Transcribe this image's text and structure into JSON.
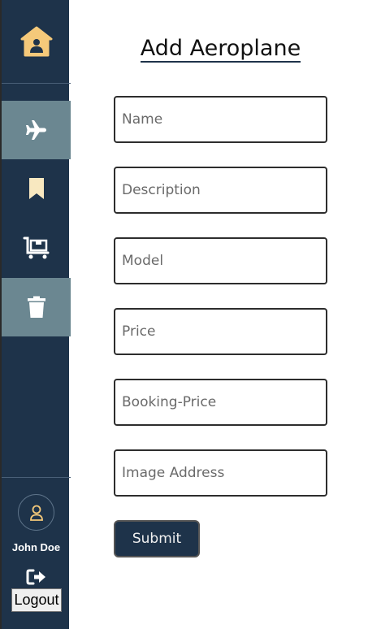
{
  "sidebar": {
    "items": [
      {
        "name": "home",
        "icon": "home-icon"
      },
      {
        "name": "aeroplanes",
        "icon": "plane-icon",
        "active": true
      },
      {
        "name": "bookmarks",
        "icon": "bookmark-icon"
      },
      {
        "name": "cart",
        "icon": "cart-icon"
      },
      {
        "name": "delete",
        "icon": "trash-icon",
        "active": true
      }
    ],
    "user": {
      "name": "John Doe",
      "avatar_icon": "user-icon"
    },
    "logout_label": "Logout"
  },
  "colors": {
    "sidebar_bg": "#1e334a",
    "active_bg": "#6b8791",
    "icon_accent": "#f5c97a",
    "icon_white": "#ffffff"
  },
  "form": {
    "title": "Add Aeroplane",
    "fields": {
      "name": {
        "placeholder": "Name",
        "value": ""
      },
      "description": {
        "placeholder": "Description",
        "value": ""
      },
      "model": {
        "placeholder": "Model",
        "value": ""
      },
      "price": {
        "placeholder": "Price",
        "value": ""
      },
      "booking_price": {
        "placeholder": "Booking-Price",
        "value": ""
      },
      "image_address": {
        "placeholder": "Image Address",
        "value": ""
      }
    },
    "submit_label": "Submit"
  }
}
